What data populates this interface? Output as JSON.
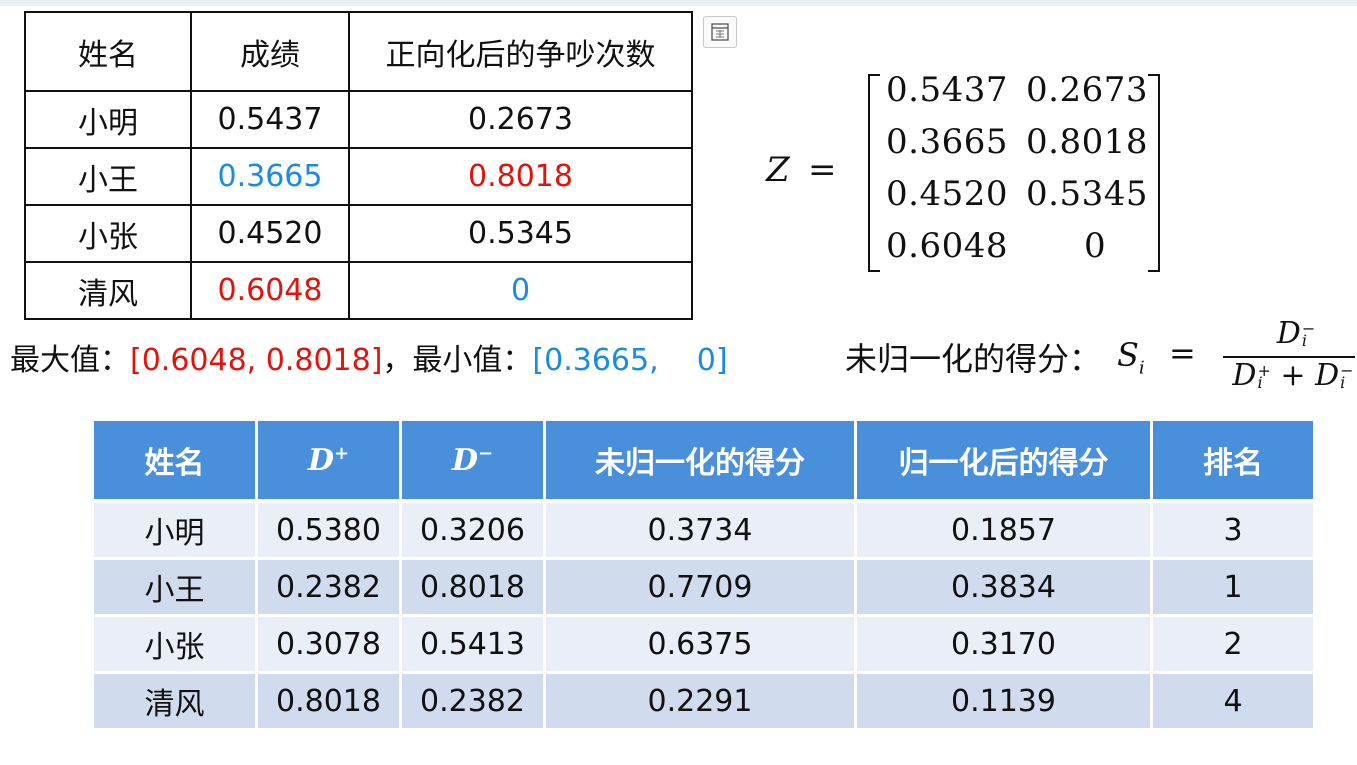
{
  "table1": {
    "headers": [
      "姓名",
      "成绩",
      "正向化后的争吵次数"
    ],
    "rows": [
      {
        "name": "小明",
        "score": "0.5437",
        "quarrel": "0.2673"
      },
      {
        "name": "小王",
        "score": "0.3665",
        "quarrel": "0.8018"
      },
      {
        "name": "小张",
        "score": "0.4520",
        "quarrel": "0.5345"
      },
      {
        "name": "清风",
        "score": "0.6048",
        "quarrel": "0"
      }
    ]
  },
  "matrix": {
    "symbol": "Z",
    "equals": "=",
    "rows": [
      [
        "0.5437",
        "0.2673"
      ],
      [
        "0.3665",
        "0.8018"
      ],
      [
        "0.4520",
        "0.5345"
      ],
      [
        "0.6048",
        "0"
      ]
    ]
  },
  "minmax": {
    "max_label": "最大值：",
    "max_value": "[0.6048,  0.8018]",
    "separator": "，",
    "min_label": "最小值：",
    "min_value": "[0.3665,    0]"
  },
  "formula": {
    "label": "未归一化的得分：",
    "lhs": "S",
    "lhs_sub": "i",
    "equals": "=",
    "numerator": "D",
    "numerator_sup": "−",
    "numerator_sub": "i",
    "den_a": "D",
    "den_a_sup": "+",
    "den_a_sub": "i",
    "den_plus": " + ",
    "den_b": "D",
    "den_b_sup": "−",
    "den_b_sub": "i"
  },
  "table2": {
    "headers": {
      "name": "姓名",
      "dplus": "D",
      "dplus_sup": "+",
      "dminus": "D",
      "dminus_sup": "−",
      "raw": "未归一化的得分",
      "norm": "归一化后的得分",
      "rank": "排名"
    },
    "rows": [
      {
        "name": "小明",
        "dplus": "0.5380",
        "dminus": "0.3206",
        "raw": "0.3734",
        "norm": "0.1857",
        "rank": "3"
      },
      {
        "name": "小王",
        "dplus": "0.2382",
        "dminus": "0.8018",
        "raw": "0.7709",
        "norm": "0.3834",
        "rank": "1"
      },
      {
        "name": "小张",
        "dplus": "0.3078",
        "dminus": "0.5413",
        "raw": "0.6375",
        "norm": "0.3170",
        "rank": "2"
      },
      {
        "name": "清风",
        "dplus": "0.8018",
        "dminus": "0.2382",
        "raw": "0.2291",
        "norm": "0.1139",
        "rank": "4"
      }
    ]
  },
  "colors": {
    "max_red": "#e0140f",
    "min_blue": "#1a8ce0",
    "header_blue": "#4a8fd9",
    "row_dark": "#d0dcee",
    "row_light": "#e9eef7"
  },
  "icons": {
    "expand": "expand-icon"
  }
}
